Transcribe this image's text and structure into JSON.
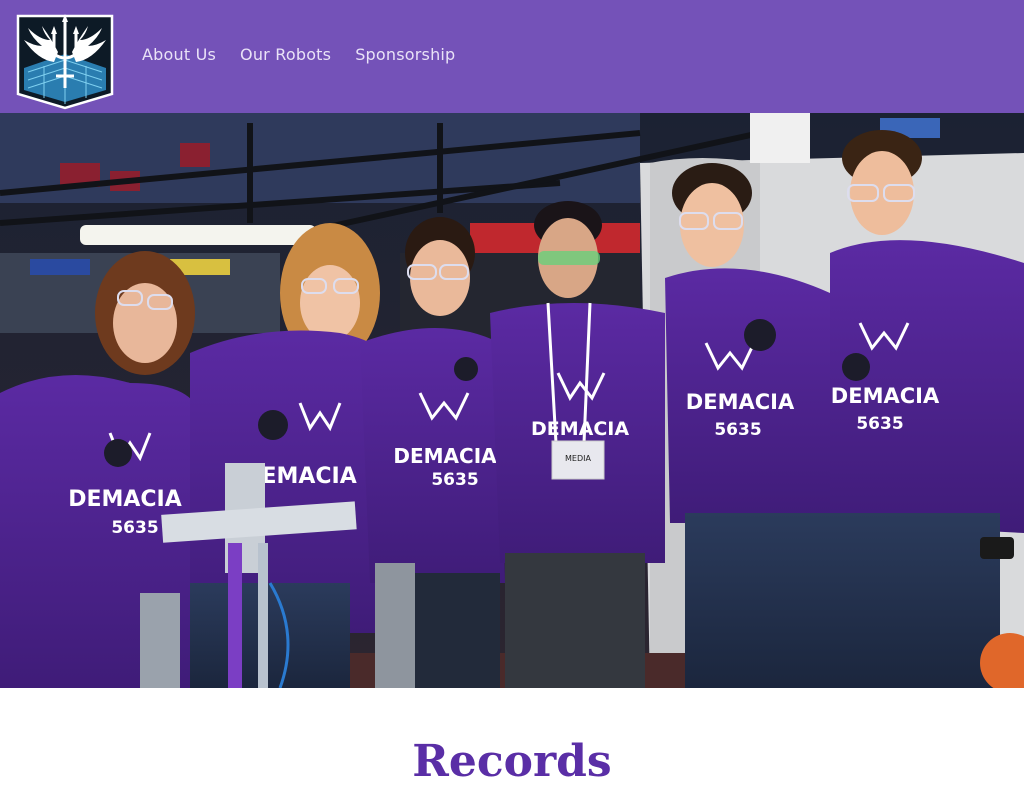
{
  "header": {
    "nav": [
      {
        "label": "About Us"
      },
      {
        "label": "Our Robots"
      },
      {
        "label": "Sponsorship"
      }
    ],
    "bg_color": "#7452b8"
  },
  "hero": {
    "shirt_brand": "DEMACIA",
    "shirt_number": "5635",
    "badge_text": "MEDIA",
    "slide_count": 5,
    "active_slide": 4
  },
  "section": {
    "title": "Records"
  },
  "icons": {
    "logo": "winged-trident-logo"
  }
}
